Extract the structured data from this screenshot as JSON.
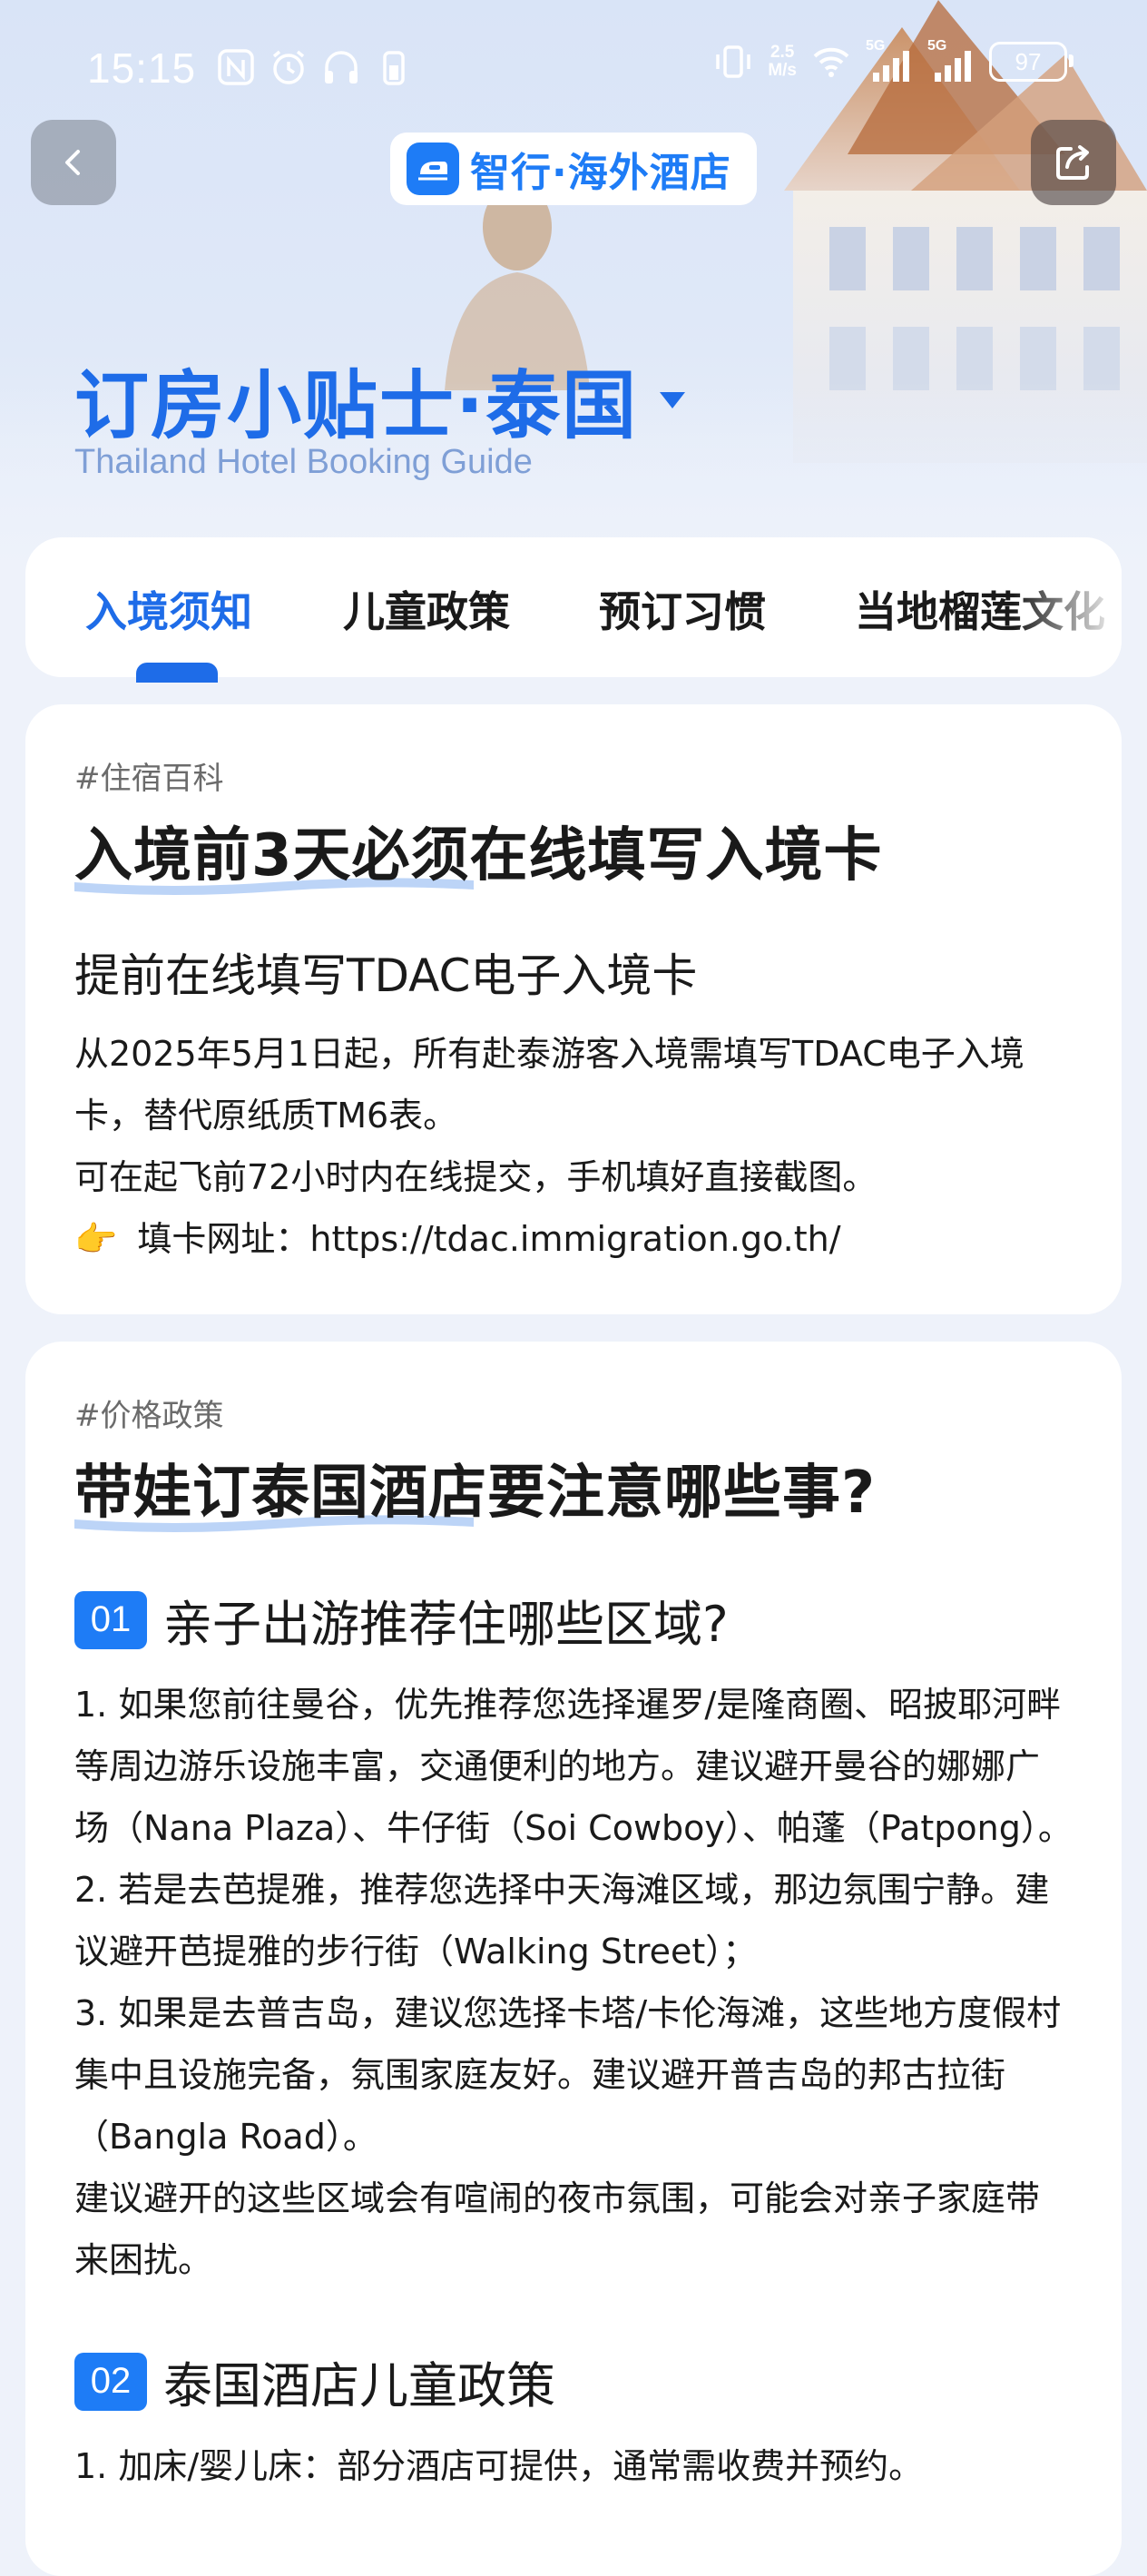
{
  "status_bar": {
    "time": "15:15",
    "net_speed_value": "2.5",
    "net_speed_unit": "M/s",
    "signal_1": "5G",
    "signal_2": "5G",
    "battery": "97"
  },
  "nav": {
    "brand_name": "智行·海外酒店"
  },
  "header": {
    "title": "订房小贴士·泰国",
    "subtitle": "Thailand Hotel Booking Guide"
  },
  "tabs": [
    {
      "label": "入境须知"
    },
    {
      "label": "儿童政策"
    },
    {
      "label": "预订习惯"
    },
    {
      "label": "当地榴莲文化"
    }
  ],
  "card1": {
    "tag": "#住宿百科",
    "title": "入境前3天必须在线填写入境卡",
    "heading": "提前在线填写TDAC电子入境卡",
    "p1": "从2025年5月1日起，所有赴泰游客入境需填写TDAC电子入境卡，替代原纸质TM6表。",
    "p2": "可在起飞前72小时内在线提交，手机填好直接截图。",
    "p3_emoji": "👉",
    "p3": "填卡网址：https://tdac.immigration.go.th/"
  },
  "card2": {
    "tag": "#价格政策",
    "title": "带娃订泰国酒店要注意哪些事?",
    "s1_num": "01",
    "s1_title": "亲子出游推荐住哪些区域?",
    "s1_p1": "1. 如果您前往曼谷，优先推荐您选择暹罗/是隆商圈、昭披耶河畔等周边游乐设施丰富，交通便利的地方。建议避开曼谷的娜娜广场（Nana Plaza）、牛仔街（Soi Cowboy）、帕蓬（Patpong）。",
    "s1_p2": "2. 若是去芭提雅，推荐您选择中天海滩区域，那边氛围宁静。建议避开芭提雅的步行街（Walking Street）；",
    "s1_p3": "3. 如果是去普吉岛，建议您选择卡塔/卡伦海滩，这些地方度假村集中且设施完备，氛围家庭友好。建议避开普吉岛的邦古拉街（Bangla Road）。",
    "s1_p4": "建议避开的这些区域会有喧闹的夜市氛围，可能会对亲子家庭带来困扰。",
    "s2_num": "02",
    "s2_title": "泰国酒店儿童政策",
    "s2_p1": "1. 加床/婴儿床：部分酒店可提供，通常需收费并预约。"
  }
}
